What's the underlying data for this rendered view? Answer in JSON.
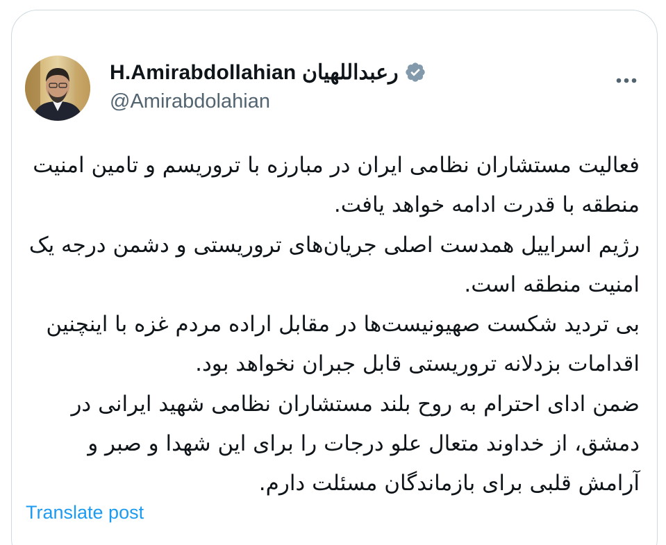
{
  "tweet": {
    "display_name": "H.Amirabdollahian رعبداللهیان",
    "handle": "@Amirabdolahian",
    "verified": true,
    "verified_badge_color": "#829aab",
    "more_icon": "more-horizontal-icon",
    "avatar_icon": "profile-photo",
    "text": "فعالیت مستشاران نظامی ایران در مبارزه با تروریسم و تامین امنیت منطقه با قدرت ادامه خواهد یافت.\nرژیم اسراییل همدست اصلی جریان‌های تروریستی و دشمن درجه یک امنیت منطقه است.\nبی تردید شکست صهیونیست‌ها در مقابل اراده مردم غزه با اینچنین اقدامات بزدلانه تروریستی قابل جبران نخواهد بود.\nضمن ادای احترام به روح بلند مستشاران نظامی شهید ایرانی در دمشق، از خداوند متعال علو درجات را برای این شهدا و صبر و آرامش قلبی برای بازماندگان مسئلت دارم.",
    "translate_label": "Translate post",
    "link_color": "#1d9bf0"
  }
}
